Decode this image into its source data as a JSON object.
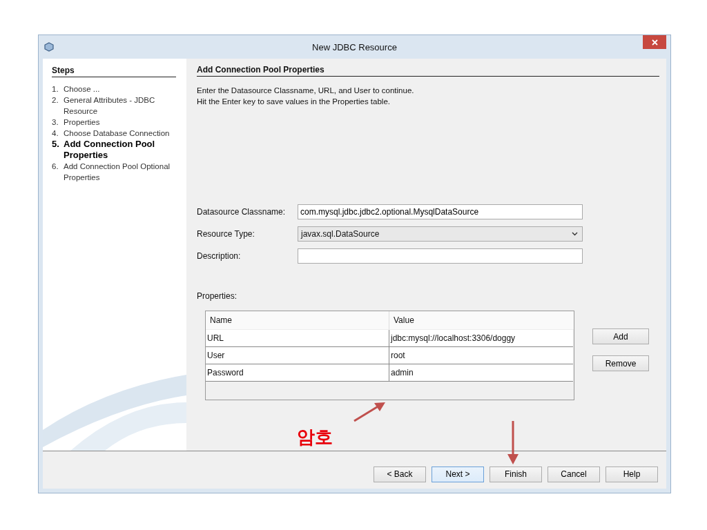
{
  "window": {
    "title": "New JDBC Resource"
  },
  "steps": {
    "title": "Steps",
    "items": [
      {
        "number": "1.",
        "label": "Choose ...",
        "selected": false
      },
      {
        "number": "2.",
        "label": "General Attributes - JDBC Resource",
        "selected": false
      },
      {
        "number": "3.",
        "label": "Properties",
        "selected": false
      },
      {
        "number": "4.",
        "label": "Choose Database Connection",
        "selected": false
      },
      {
        "number": "5.",
        "label": "Add Connection Pool Properties",
        "selected": true
      },
      {
        "number": "6.",
        "label": "Add Connection Pool Optional Properties",
        "selected": false
      }
    ]
  },
  "panel": {
    "title": "Add Connection Pool Properties",
    "description": [
      "Enter the Datasource Classname, URL, and User to continue.",
      "Hit the Enter key to save values in the Properties table."
    ]
  },
  "form": [
    {
      "kind": "text",
      "label": "Datasource Classname:",
      "value": "com.mysql.jdbc.jdbc2.optional.MysqlDataSource"
    },
    {
      "kind": "dropdown",
      "label": "Resource Type:",
      "value": "javax.sql.DataSource"
    },
    {
      "kind": "text",
      "label": "Description:"
    }
  ],
  "properties": {
    "label": "Properties:",
    "columns": [
      "Name",
      "Value"
    ],
    "rows": [
      [
        "URL",
        "jdbc:mysql://localhost:3306/doggy"
      ],
      [
        "User",
        "root"
      ],
      [
        "Password",
        "admin"
      ]
    ],
    "buttons": [
      "Add",
      "Remove"
    ]
  },
  "footer_buttons": [
    {
      "label": "< Back",
      "default": false
    },
    {
      "label": "Next >",
      "default": true
    },
    {
      "label": "Finish",
      "default": false
    },
    {
      "label": "Cancel",
      "default": false
    },
    {
      "label": "Help",
      "default": false
    }
  ],
  "annotation": {
    "text": "암호"
  }
}
